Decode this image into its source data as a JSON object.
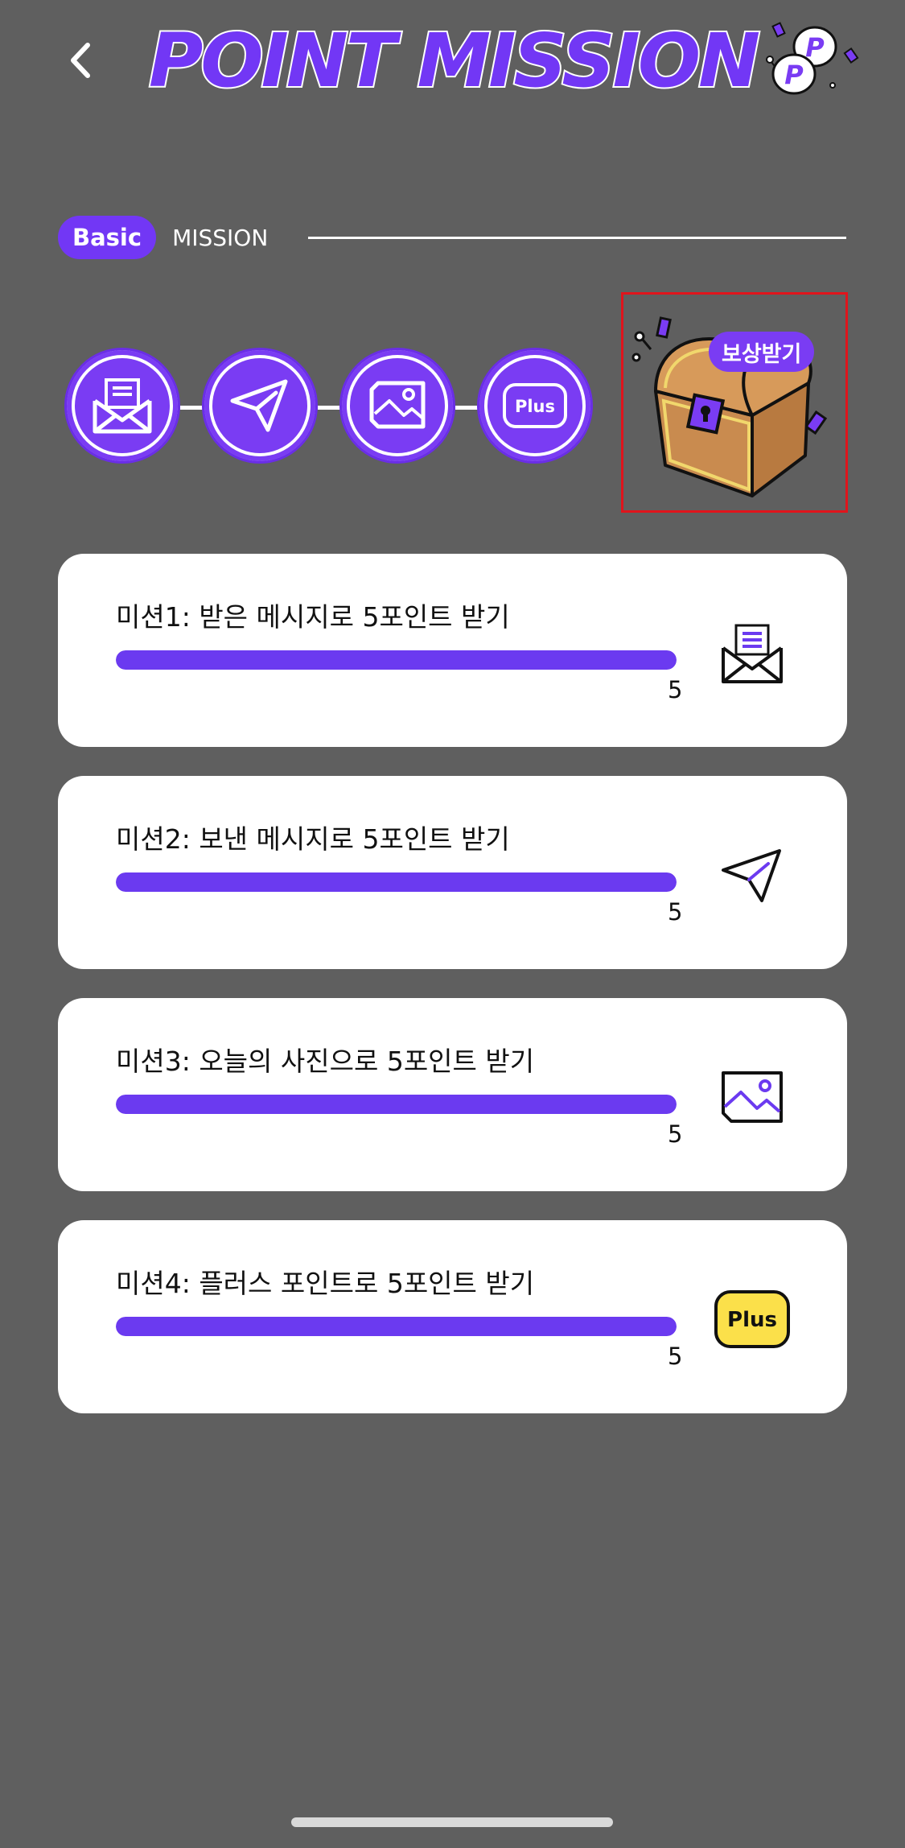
{
  "header": {
    "title": "POINT MISSION",
    "badge_letters": [
      "P",
      "P"
    ]
  },
  "section": {
    "basic_label": "Basic",
    "mission_label": "MISSION"
  },
  "steps": [
    {
      "icon": "envelope-icon"
    },
    {
      "icon": "paper-plane-icon"
    },
    {
      "icon": "image-icon"
    },
    {
      "icon": "plus-icon",
      "label": "Plus"
    }
  ],
  "reward": {
    "label": "보상받기",
    "icon": "treasure-chest-icon"
  },
  "missions": [
    {
      "title": "미션1: 받은 메시지로 5포인트 받기",
      "count": "5",
      "progress": 1.0,
      "icon": "envelope-icon"
    },
    {
      "title": "미션2: 보낸 메시지로 5포인트 받기",
      "count": "5",
      "progress": 1.0,
      "icon": "paper-plane-icon"
    },
    {
      "title": "미션3: 오늘의 사진으로 5포인트 받기",
      "count": "5",
      "progress": 1.0,
      "icon": "image-icon"
    },
    {
      "title": "미션4: 플러스 포인트로 5포인트 받기",
      "count": "5",
      "progress": 1.0,
      "icon": "plus-icon",
      "icon_label": "Plus"
    }
  ],
  "colors": {
    "accent": "#6b3af0",
    "background": "#5f5f5f",
    "plus_yellow": "#fbe04a",
    "reward_border": "#e0141c"
  }
}
